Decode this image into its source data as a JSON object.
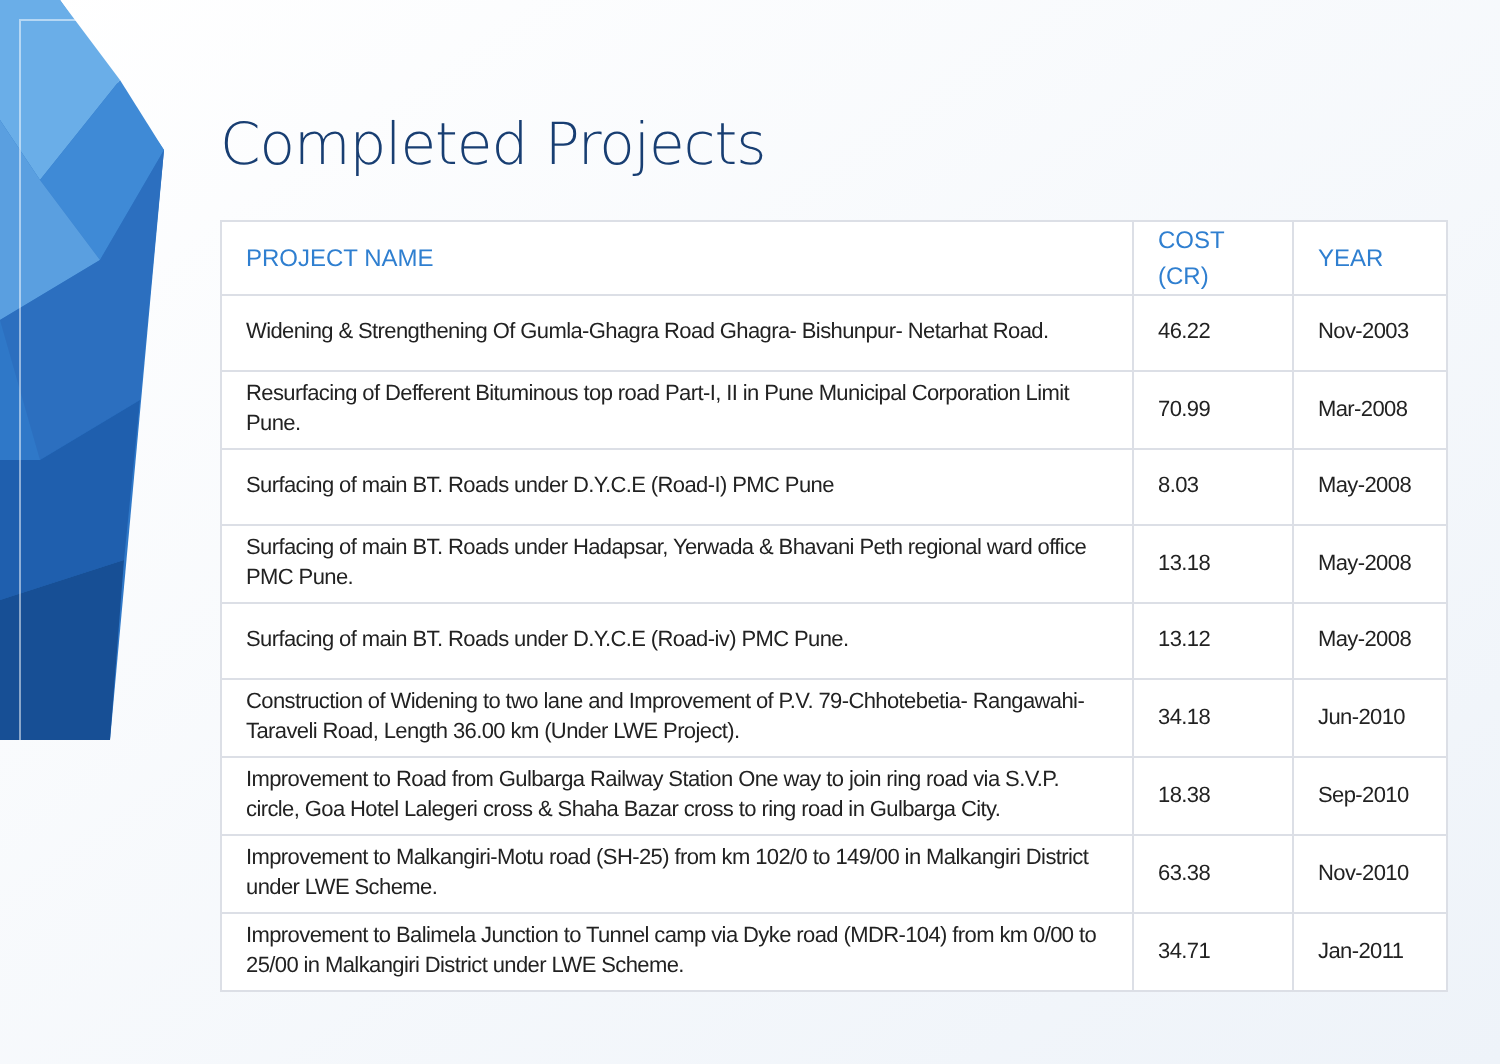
{
  "title": "Completed Projects",
  "table": {
    "columns": [
      "PROJECT NAME",
      "COST (CR)",
      "YEAR"
    ],
    "rows": [
      [
        "Widening & Strengthening Of Gumla-Ghagra Road Ghagra- Bishunpur- Netarhat Road.",
        "46.22",
        "Nov-2003"
      ],
      [
        "Resurfacing of Defferent Bituminous top road Part-I, II in Pune Municipal Corporation Limit Pune.",
        "70.99",
        "Mar-2008"
      ],
      [
        "Surfacing of main BT. Roads under D.Y.C.E (Road-I) PMC Pune",
        "8.03",
        "May-2008"
      ],
      [
        "Surfacing of main BT. Roads under Hadapsar, Yerwada & Bhavani Peth regional ward office PMC Pune.",
        "13.18",
        "May-2008"
      ],
      [
        "Surfacing of main BT. Roads under D.Y.C.E (Road-iv) PMC Pune.",
        "13.12",
        "May-2008"
      ],
      [
        "Construction of Widening to two lane and Improvement of P.V. 79-Chhotebetia- Rangawahi- Taraveli Road, Length 36.00 km (Under LWE Project).",
        "34.18",
        "Jun-2010"
      ],
      [
        "Improvement to Road from Gulbarga Railway Station One way to join ring road via S.V.P. circle, Goa Hotel Lalegeri cross & Shaha Bazar cross to ring road in Gulbarga City.",
        "18.38",
        "Sep-2010"
      ],
      [
        "Improvement to Malkangiri-Motu road (SH-25) from km 102/0 to 149/00 in Malkangiri District under LWE Scheme.",
        "63.38",
        "Nov-2010"
      ],
      [
        "Improvement to Balimela Junction to Tunnel camp via Dyke road (MDR-104) from km 0/00 to 25/00 in Malkangiri District under LWE Scheme.",
        "34.71",
        "Jan-2011"
      ]
    ]
  }
}
